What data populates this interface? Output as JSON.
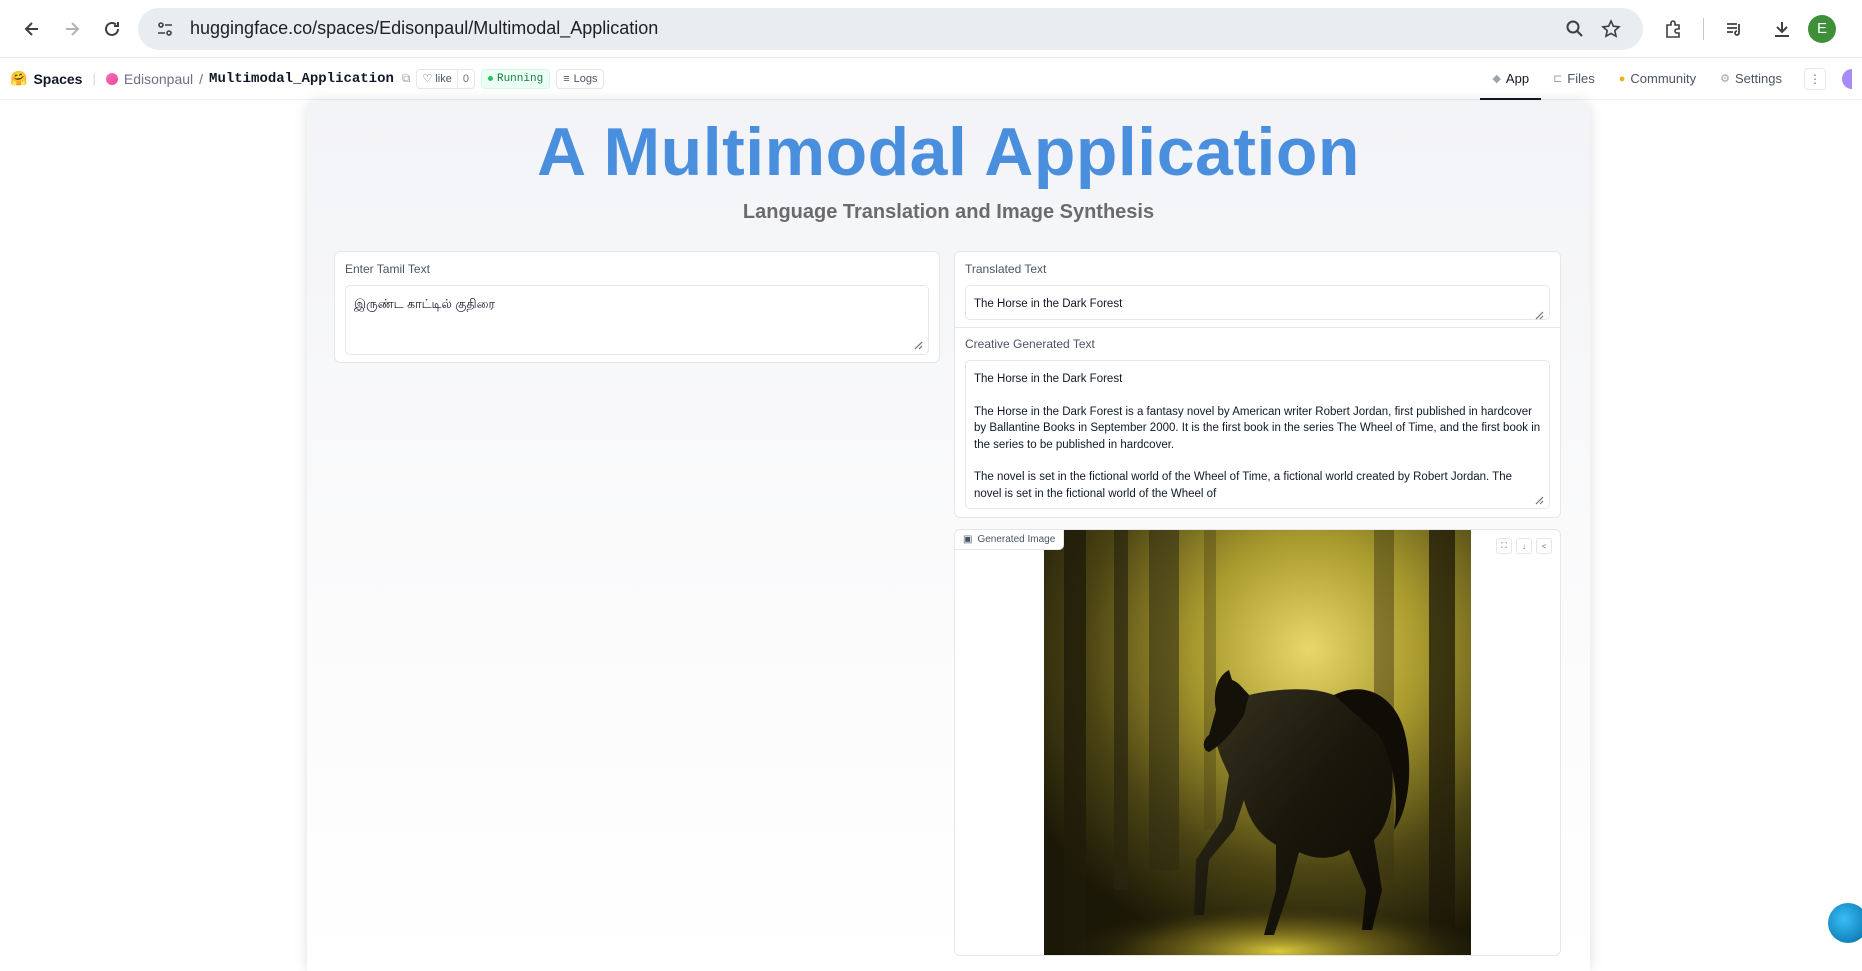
{
  "browser": {
    "url": "huggingface.co/spaces/Edisonpaul/Multimodal_Application",
    "profile_initial": "E"
  },
  "hf_header": {
    "emoji": "🤗",
    "spaces_label": "Spaces",
    "owner": "Edisonpaul",
    "repo": "Multimodal_Application",
    "like_label": "like",
    "like_count": "0",
    "status": "Running",
    "logs_label": "Logs",
    "tabs": [
      {
        "label": "App",
        "icon": "app-icon",
        "active": true
      },
      {
        "label": "Files",
        "icon": "files-icon",
        "active": false
      },
      {
        "label": "Community",
        "icon": "community-icon",
        "active": false
      },
      {
        "label": "Settings",
        "icon": "gear-icon",
        "active": false
      }
    ]
  },
  "app": {
    "title": "A Multimodal Application",
    "subtitle": "Language Translation and Image Synthesis",
    "input": {
      "label": "Enter Tamil Text",
      "value": "இருண்ட காட்டில் குதிரை"
    },
    "translated": {
      "label": "Translated Text",
      "value": "The Horse in the Dark Forest"
    },
    "creative": {
      "label": "Creative Generated Text",
      "paragraphs": [
        "The Horse in the Dark Forest",
        "The Horse in the Dark Forest is a fantasy novel by American writer Robert Jordan, first published in hardcover by Ballantine Books in September 2000. It is the first book in the series The Wheel of Time, and the first book in the series to be published in hardcover.",
        "The novel is set in the fictional world of the Wheel of Time, a fictional world created by Robert Jordan. The novel is set in the fictional world of the Wheel of"
      ]
    },
    "image": {
      "label": "Generated Image"
    }
  },
  "colors": {
    "title": "#4a8fde",
    "running_green": "#15803d",
    "accent_yellow": "#d4c22a"
  }
}
